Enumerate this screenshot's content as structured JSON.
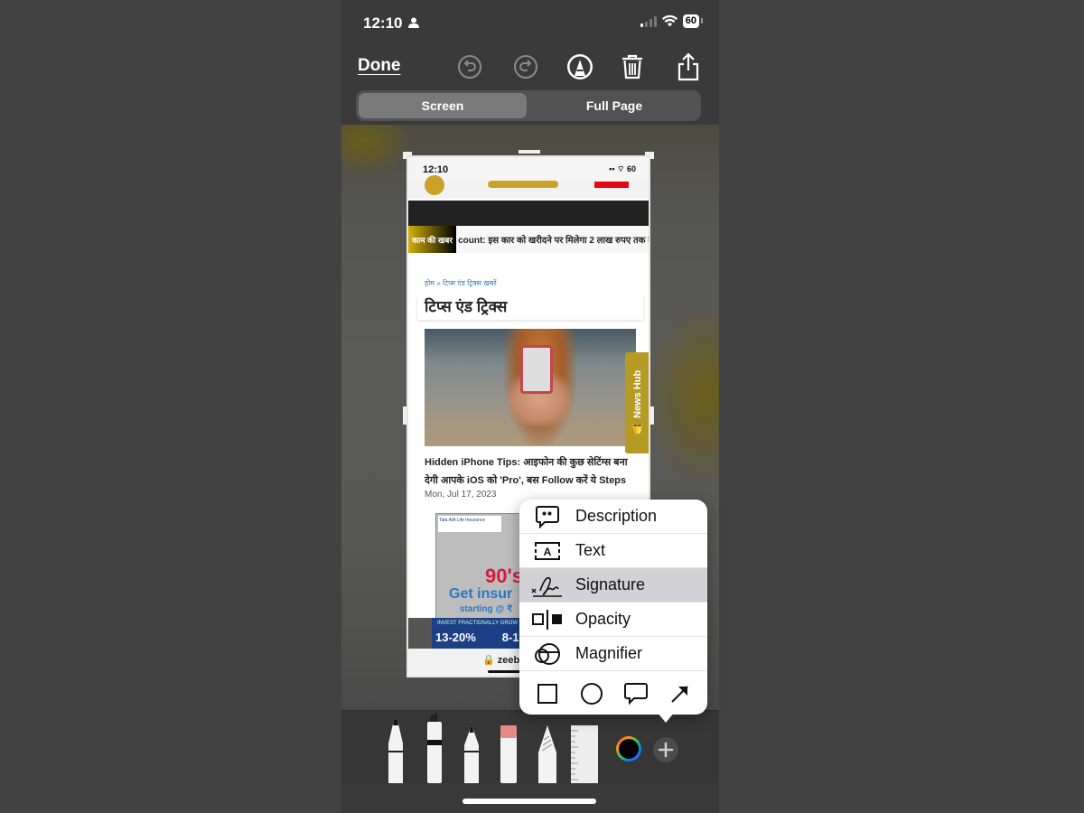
{
  "status_bar": {
    "time": "12:10",
    "battery": "60",
    "icons": [
      "person-icon",
      "signal-icon",
      "wifi-icon",
      "battery-icon"
    ]
  },
  "toolbar": {
    "done_label": "Done",
    "icons": [
      "undo-icon",
      "redo-icon",
      "markup-pen-icon",
      "trash-icon",
      "share-icon"
    ]
  },
  "segment": {
    "options": [
      "Screen",
      "Full Page"
    ],
    "selected": "Screen"
  },
  "screenshot": {
    "status_time": "12:10",
    "battery": "60",
    "ticker_label": "काम की खबर",
    "ticker_text": "count: इस कार को खरीदने पर मिलेगा 2 लाख रुपए तक का",
    "breadcrumb": "होम » टिप्स एंड ट्रिक्स खबरें",
    "section_title": "टिप्स एंड ट्रिक्स",
    "news_hub_label": "News Hub",
    "article_title": "Hidden iPhone Tips: आइफोन की कुछ सेटिंग्स बना देगी आपके iOS को 'Pro', बस Follow करें ये Steps",
    "article_date": "Mon, Jul 17, 2023",
    "ad": {
      "brand": "Tata AIA Life Insurance",
      "headline_number": "90's",
      "headline": "Get insur",
      "subline": "starting @ ₹",
      "invest_line": "INVEST FRACTIONALLY GROW E",
      "invest_rate": "13-20%",
      "invest_rate2": "8-1"
    },
    "url": "zeebiz."
  },
  "popup_menu": {
    "items": [
      {
        "label": "Description",
        "icon": "description-icon",
        "selected": false
      },
      {
        "label": "Text",
        "icon": "text-box-icon",
        "selected": false
      },
      {
        "label": "Signature",
        "icon": "signature-icon",
        "selected": true
      },
      {
        "label": "Opacity",
        "icon": "opacity-icon",
        "selected": false
      },
      {
        "label": "Magnifier",
        "icon": "magnifier-icon",
        "selected": false
      }
    ],
    "shapes": [
      "square-shape-icon",
      "circle-shape-icon",
      "speech-bubble-shape-icon",
      "arrow-shape-icon"
    ]
  },
  "drawing_tools": [
    "pen-tool",
    "marker-tool",
    "pencil-tool",
    "eraser-tool",
    "lasso-tool",
    "ruler-tool",
    "color-picker",
    "add-button"
  ],
  "colors": {
    "selected_highlight": "#d1d1d6",
    "news_hub": "#b59a26",
    "accent_gold": "#c9a227"
  }
}
